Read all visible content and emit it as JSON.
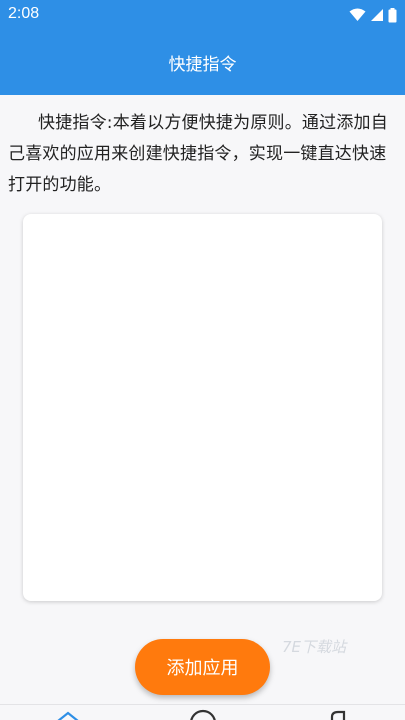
{
  "status_bar": {
    "time": "2:08",
    "icons": [
      "wifi-icon",
      "signal-icon",
      "battery-icon"
    ]
  },
  "header": {
    "title": "快捷指令"
  },
  "intro": {
    "text": "快捷指令:本着以方便快捷为原则。通过添加自己喜欢的应用来创建快捷指令，实现一键直达快速打开的功能。"
  },
  "actions": {
    "add_label": "添加应用"
  },
  "watermark": {
    "text": "7E下载站"
  },
  "bottom_nav": {
    "icons": [
      "home-icon",
      "search-icon",
      "profile-icon"
    ]
  },
  "colors": {
    "header": "#2e8fe6",
    "accent": "#ff7a0d",
    "background": "#f7f7f9"
  }
}
